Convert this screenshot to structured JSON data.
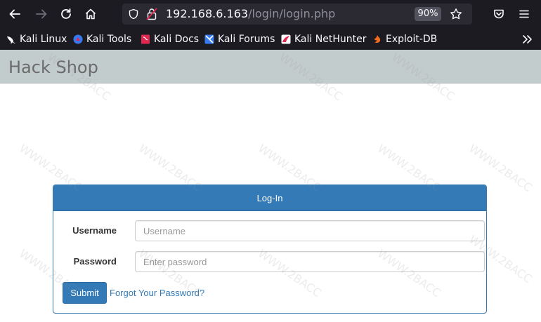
{
  "browser": {
    "url_host": "192.168.6.163",
    "url_path": "/login/login.php",
    "zoom": "90%",
    "bookmarks": [
      {
        "label": "Kali Linux",
        "icon": "kali-dragon-icon"
      },
      {
        "label": "Kali Tools",
        "icon": "kali-tools-icon"
      },
      {
        "label": "Kali Docs",
        "icon": "kali-docs-icon"
      },
      {
        "label": "Kali Forums",
        "icon": "kali-forums-icon"
      },
      {
        "label": "Kali NetHunter",
        "icon": "kali-nethunter-icon"
      },
      {
        "label": "Exploit-DB",
        "icon": "exploit-db-icon"
      }
    ]
  },
  "page": {
    "brand": "Hack Shop",
    "login": {
      "heading": "Log-In",
      "username_label": "Username",
      "username_placeholder": "Username",
      "password_label": "Password",
      "password_placeholder": "Enter password",
      "submit_label": "Submit",
      "forgot_label": "Forgot Your Password?"
    },
    "watermark": "WWW.2BACC"
  },
  "colors": {
    "chrome_bg": "#1c1b22",
    "navbar_bg": "#c3cccd",
    "primary": "#337ab7"
  }
}
